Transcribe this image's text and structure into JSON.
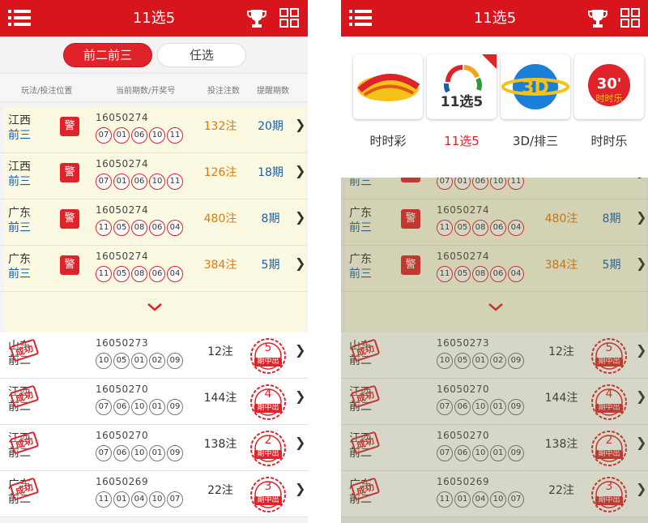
{
  "app_title": "11选5",
  "tabs": [
    "前二前三",
    "任选"
  ],
  "col_headers": [
    "玩法/投注位置",
    "当前期数/开奖号",
    "投注注数",
    "提醒期数"
  ],
  "warn_label": "警",
  "highlight_rows": [
    {
      "region": "江西",
      "sub": "前三",
      "period": "16050274",
      "balls": [
        "07",
        "01",
        "06",
        "10",
        "11"
      ],
      "bets": "132注",
      "remind": "20期"
    },
    {
      "region": "江西",
      "sub": "前三",
      "period": "16050274",
      "balls": [
        "07",
        "01",
        "06",
        "10",
        "11"
      ],
      "bets": "126注",
      "remind": "18期"
    },
    {
      "region": "广东",
      "sub": "前三",
      "period": "16050274",
      "balls": [
        "11",
        "05",
        "08",
        "06",
        "04"
      ],
      "bets": "480注",
      "remind": "8期"
    },
    {
      "region": "广东",
      "sub": "前三",
      "period": "16050274",
      "balls": [
        "11",
        "05",
        "08",
        "06",
        "04"
      ],
      "bets": "384注",
      "remind": "5期"
    }
  ],
  "success_stamp": "成功",
  "badge_text": "期中出",
  "success_rows": [
    {
      "region": "山东",
      "sub": "前二",
      "period": "16050273",
      "balls": [
        "10",
        "05",
        "01",
        "02",
        "09"
      ],
      "bets": "12注",
      "hit": "5"
    },
    {
      "region": "江西",
      "sub": "前二",
      "period": "16050270",
      "balls": [
        "07",
        "06",
        "10",
        "01",
        "09"
      ],
      "bets": "144注",
      "hit": "4"
    },
    {
      "region": "江西",
      "sub": "前二",
      "period": "16050270",
      "balls": [
        "07",
        "06",
        "10",
        "01",
        "09"
      ],
      "bets": "138注",
      "hit": "2"
    },
    {
      "region": "广东",
      "sub": "前二",
      "period": "16050269",
      "balls": [
        "11",
        "01",
        "04",
        "10",
        "07"
      ],
      "bets": "22注",
      "hit": "3"
    }
  ],
  "lottery_menu": [
    {
      "label": "时时彩"
    },
    {
      "label": "11选5",
      "logo_text": "11选5",
      "selected": true
    },
    {
      "label": "3D/排三",
      "logo_text": "3D"
    },
    {
      "label": "时时乐",
      "logo_text": "30'",
      "logo_sub": "时时乐"
    }
  ],
  "colors": {
    "brand_red": "#d8141c",
    "orange": "#e07a10",
    "blue": "#1a5ea8",
    "highlight_bg": "#fbf9e2"
  }
}
